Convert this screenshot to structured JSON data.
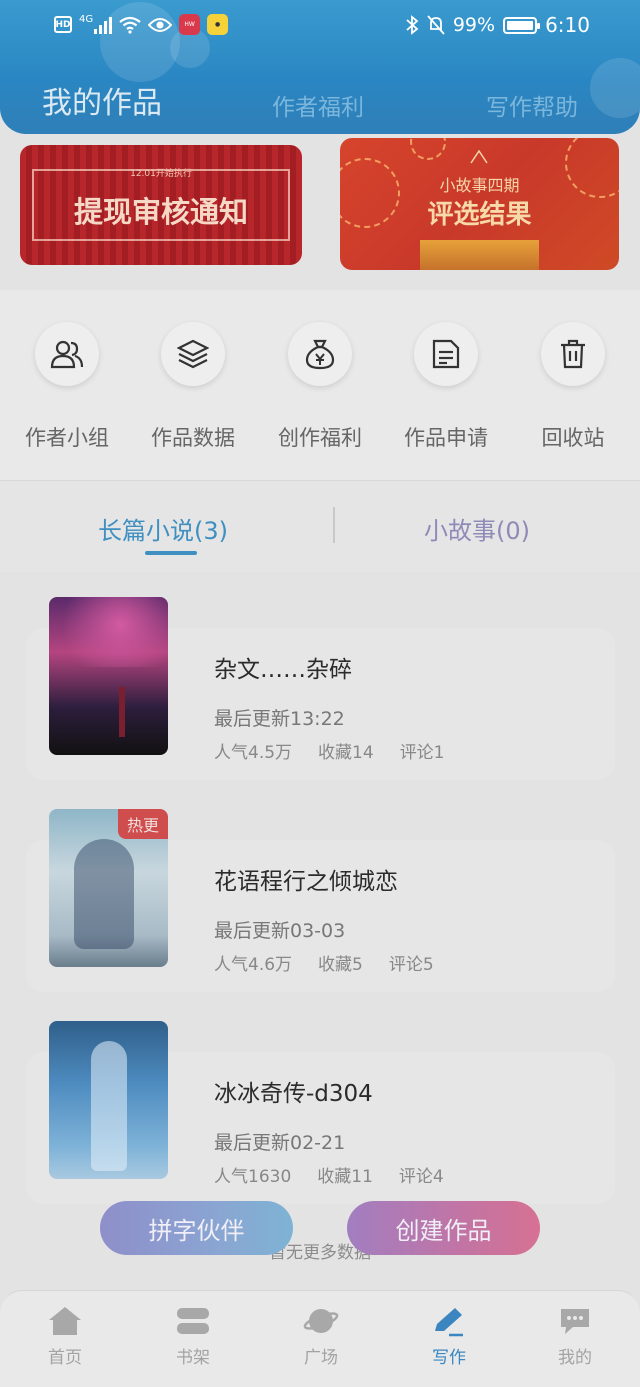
{
  "status_bar": {
    "hd": "HD",
    "network": "4G",
    "battery": "99%",
    "time": "6:10",
    "battery_level": 0.99
  },
  "header": {
    "title": "我的作品",
    "tabs": [
      "作者福利",
      "写作帮助"
    ]
  },
  "banners": [
    {
      "small_text": "12.01开始执行",
      "title": "提现审核通知"
    },
    {
      "line1": "小故事四期",
      "line2": "评选结果"
    }
  ],
  "quick_actions": [
    {
      "label": "作者小组",
      "icon": "people-icon"
    },
    {
      "label": "作品数据",
      "icon": "layers-icon"
    },
    {
      "label": "创作福利",
      "icon": "money-bag-icon"
    },
    {
      "label": "作品申请",
      "icon": "document-icon"
    },
    {
      "label": "回收站",
      "icon": "trash-icon"
    }
  ],
  "tabs": {
    "active": "长篇小说(3)",
    "other": "小故事(0)"
  },
  "works": [
    {
      "title": "杂文……杂碎",
      "update": "最后更新13:22",
      "popularity": "人气4.5万",
      "favorites": "收藏14",
      "comments": "评论1",
      "badge": ""
    },
    {
      "title": "花语程行之倾城恋",
      "update": "最后更新03-03",
      "popularity": "人气4.6万",
      "favorites": "收藏5",
      "comments": "评论5",
      "badge": "热更"
    },
    {
      "title": "冰冰奇传-d304",
      "update": "最后更新02-21",
      "popularity": "人气1630",
      "favorites": "收藏11",
      "comments": "评论4",
      "badge": ""
    }
  ],
  "floating_buttons": {
    "partner": "拼字伙伴",
    "create": "创建作品"
  },
  "no_more_text": "暂无更多数据",
  "bottom_nav": [
    {
      "label": "首页",
      "icon": "home-icon"
    },
    {
      "label": "书架",
      "icon": "bookshelf-icon"
    },
    {
      "label": "广场",
      "icon": "planet-icon"
    },
    {
      "label": "写作",
      "icon": "pen-icon",
      "active": true
    },
    {
      "label": "我的",
      "icon": "chat-icon"
    }
  ],
  "colors": {
    "header": "#2a86c2",
    "accent": "#3f8fc1",
    "hot_badge": "#cf4d4d"
  }
}
